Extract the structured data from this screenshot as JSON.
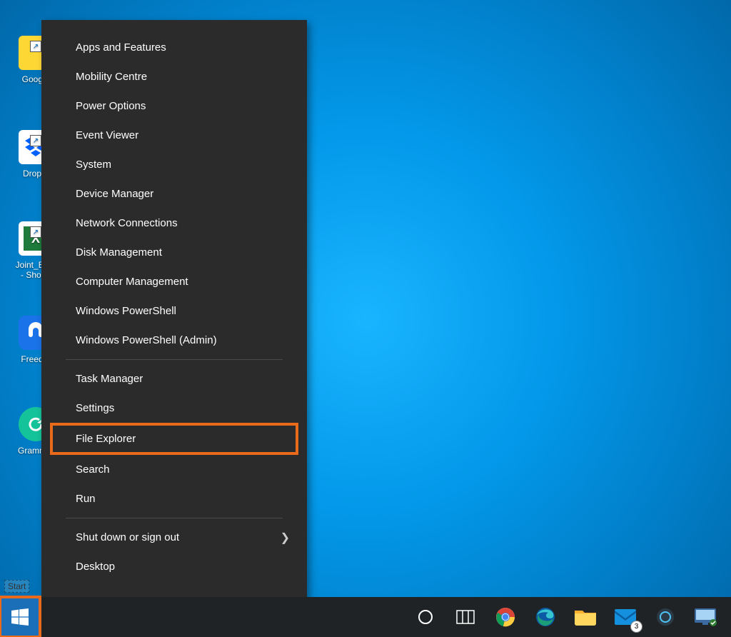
{
  "desktop_icons": [
    {
      "label": "Google",
      "color": "#fdd835"
    },
    {
      "label": "Drop...",
      "color": "#ffffff"
    },
    {
      "label_line1": "Joint_Bu...",
      "label_line2": "- Shor...",
      "color": "#1f7b3c"
    },
    {
      "label": "Freed...",
      "color": "#1a73e8"
    },
    {
      "label": "Gramm...",
      "color": "#15c39a"
    }
  ],
  "power_menu": {
    "group1": [
      "Apps and Features",
      "Mobility Centre",
      "Power Options",
      "Event Viewer",
      "System",
      "Device Manager",
      "Network Connections",
      "Disk Management",
      "Computer Management",
      "Windows PowerShell",
      "Windows PowerShell (Admin)"
    ],
    "group2": [
      "Task Manager",
      "Settings",
      "File Explorer",
      "Search",
      "Run"
    ],
    "group3": [
      {
        "label": "Shut down or sign out",
        "expand": true
      },
      {
        "label": "Desktop",
        "expand": false
      }
    ],
    "highlighted_item": "File Explorer"
  },
  "start_tooltip": "Start",
  "taskbar": {
    "badge_count": "3"
  }
}
